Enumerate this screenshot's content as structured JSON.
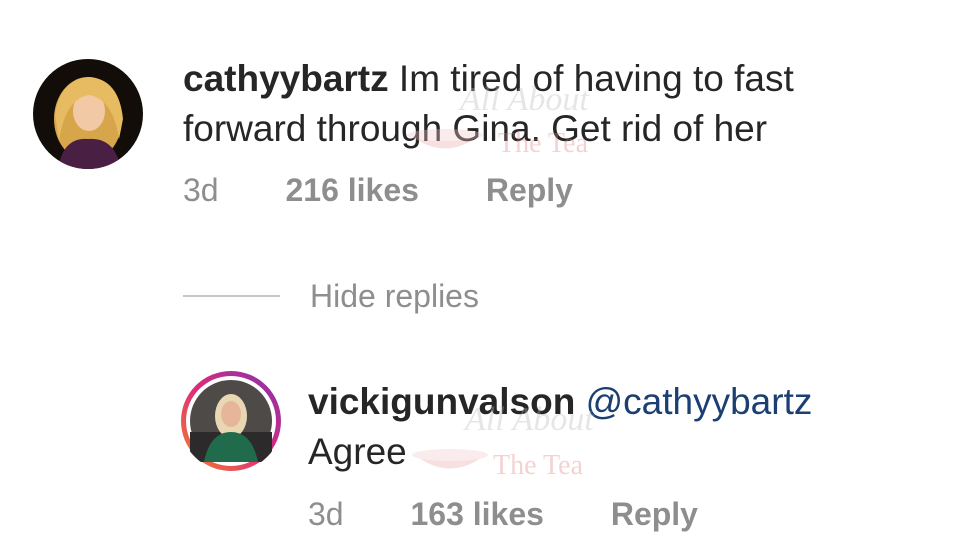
{
  "comments": [
    {
      "username": "cathyybartz",
      "text_line1": "Im tired of having to fast",
      "text_line2": "forward through Gina. Get rid of her",
      "time": "3d",
      "likes": "216 likes",
      "reply": "Reply",
      "avatar_icon": "avatar-photo-icon"
    }
  ],
  "hide_replies": "Hide replies",
  "replies": [
    {
      "username": "vickigunvalson",
      "mention": "@cathyybartz",
      "text": "Agree",
      "time": "3d",
      "likes": "163 likes",
      "reply": "Reply",
      "avatar_icon": "avatar-story-ring-icon"
    }
  ],
  "watermark": {
    "line1": "All About",
    "line2": "The Tea"
  },
  "colors": {
    "text": "#262626",
    "secondary": "#8e8e8e",
    "mention": "#1b3f73",
    "story_ring_start": "#f58529",
    "story_ring_end": "#dd2a7b"
  }
}
